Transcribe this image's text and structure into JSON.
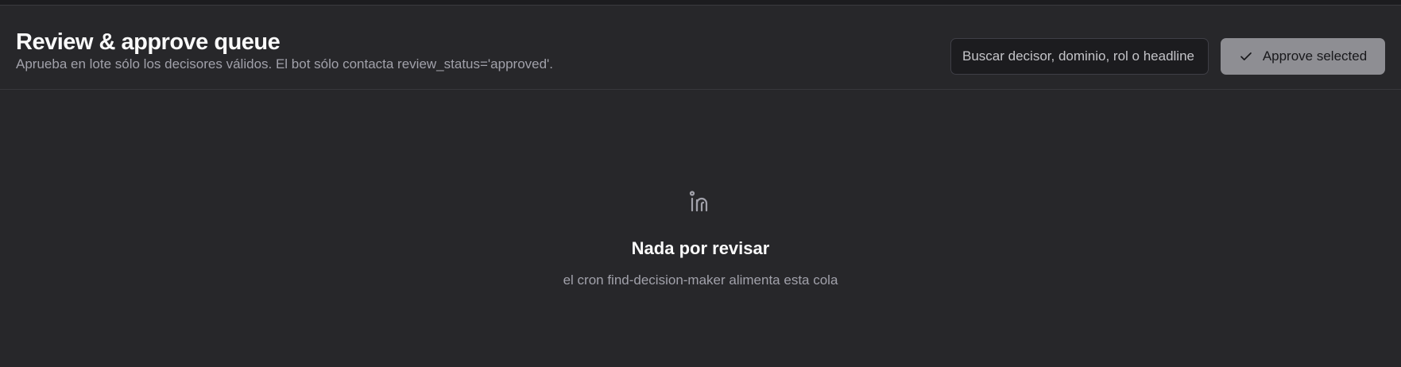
{
  "header": {
    "title": "Review & approve queue",
    "subtitle": "Aprueba en lote sólo los decisores válidos. El bot sólo contacta review_status='approved'."
  },
  "search": {
    "placeholder": "Buscar decisor, dominio, rol o headline",
    "value": ""
  },
  "actions": {
    "approve_label": "Approve selected",
    "approve_icon": "check-icon",
    "approve_disabled": true
  },
  "empty_state": {
    "icon": "linkedin-icon",
    "title": "Nada por revisar",
    "subtitle": "el cron find-decision-maker alimenta esta cola"
  },
  "colors": {
    "background": "#27272a",
    "text_primary": "#fafafa",
    "text_muted": "#a1a1aa",
    "button_bg": "#8e8e93"
  }
}
